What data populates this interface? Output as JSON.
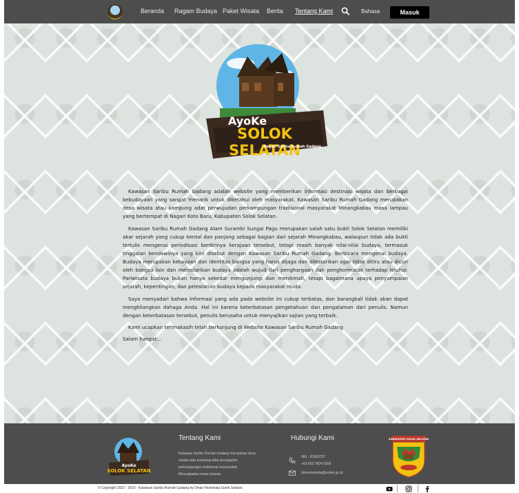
{
  "navbar": {
    "logo_alt": "AyoKe Solok Selatan",
    "links": [
      {
        "label": "Beranda"
      },
      {
        "label": "Ragam Budaya"
      },
      {
        "label": "Paket Wisata"
      },
      {
        "label": "Berita"
      },
      {
        "label": "Tentang Kami"
      },
      {
        "label": "Bahasa"
      }
    ],
    "active": "Tentang Kami",
    "search_icon": "search-icon",
    "login_label": "Masuk"
  },
  "hero": {
    "line1": "AyoKe",
    "line2": "SOLOK SELATAN",
    "tagline": "Nagari Saribu Rumah Gadang"
  },
  "article": {
    "paragraphs": [
      "Kawasan Saribu Rumah Gadang adalah website yang memberikan informasi destinasi wisata dan berbagai kebudayaan yang sangat menarik untuk diketahui oleh masyarakat. Kawasan Saribu Rumah Gadang merupakan desa wisata atau kampung adat perwujudan perkampungan tradisional masyarakat Minangkabau masa lampau yang bertempat di Nagari Koto Baru, Kabupaten Solok Selatan.",
      "Kawasan Saribu Rumah Gadang Alam Surambi Sungai Pagu merupakan salah satu bukti Solok Selatan memiliki akar sejarah yang cukup kental dan panjang sebagai bagian dari sejarah Minangkabau, walaupun tidak ada bukti tertulis mengenai periodisasi berdirinya kerajaan tersebut, tetapi masih banyak nilai-nilai budaya, termasuk tinggalan bendawinya yang kini disebut dengan Kawasan Saribu Rumah Gadang. Berbicara mengenai budaya. Budaya merupakan kekayaan dan identitas bangsa yang harus dijaga dan dilestarikan agar tidak ditiru atau dicuri oleh bangsa lain dan melestarikan budaya adalah wujud dari penghargaan dan penghormatan terhadap leluhur. Pariwisata budaya bukan hanya sekedar mengunjungi dan menikmati, tetapi bagaimana upaya penyampaian sejarah, kepentingan, dan pelestarian budaya kepada masyarakat muda.",
      "Saya menyadari bahwa informasi yang ada pada website ini cukup terbatas, dan barangkali tidak akan dapat menghilangkan dahaga Anda. Hal ini karena keterbatasan pengetahuan dan pengalaman dari penulis. Namun dengan keterbatasan tersebut, penulis berusaha untuk menyajikan sajian yang terbaik.",
      "Kami ucapkan terimakasih telah berkunjung di Website Kawasan Saribu Rumah Gadang"
    ],
    "closing": "Salam hangat..."
  },
  "footer": {
    "logo_line1": "AyoKe",
    "logo_line2": "SOLOK SELATAN",
    "about_heading": "Tentang Kami",
    "about_text": "Kawasan Saribu Rumah Gadang merupakan desa wisata atau kampung adat perwujudan perkampungan tradisional masyarakat Minangkabau masa lampau",
    "contact_heading": "Hubungi Kami",
    "phone1": "082 - 87663757",
    "phone2": "+62 815 7824 9309",
    "email": "dinkomwisata@solsel.go.id",
    "crest_title": "KABUPATEN SOLOK SELATAN"
  },
  "bottombar": {
    "copyright": "© Copyright 2022 - 2023 - Kawasan Saribu Rumah Gadang by Dinas Pariwisata Solok Selatan",
    "social": [
      "youtube-icon",
      "instagram-icon",
      "facebook-icon"
    ]
  },
  "colors": {
    "nav_bg": "#4d4d4d",
    "login_bg": "#000000",
    "accent_yellow": "#f2c211",
    "page_bg": "#dfe5e0"
  }
}
